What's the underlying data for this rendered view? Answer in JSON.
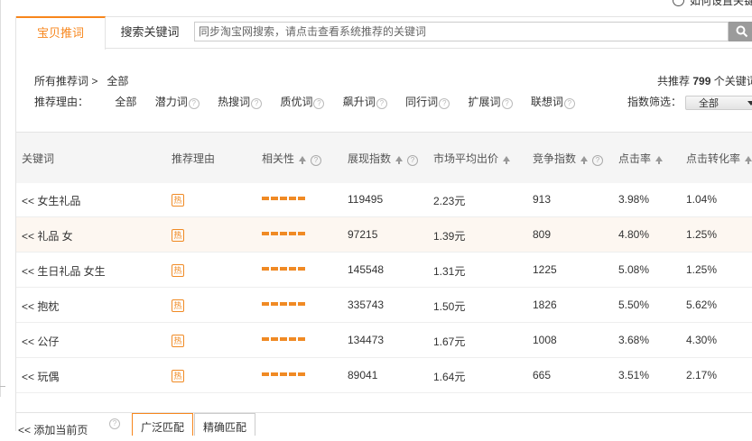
{
  "help_link": "如何设置关键",
  "tabs": [
    "宝贝推词",
    "搜索关键词"
  ],
  "search": {
    "placeholder": "同步淘宝网搜索，请点击查看系统推荐的关键词"
  },
  "breadcrumb": {
    "root": "所有推荐词 >",
    "current": "全部"
  },
  "reasons": {
    "label": "推荐理由：",
    "items": [
      "全部",
      "潜力词",
      "热搜词",
      "质优词",
      "飙升词",
      "同行词",
      "扩展词",
      "联想词"
    ]
  },
  "total": {
    "prefix": "共推荐",
    "count": "799",
    "suffix": "个关键词"
  },
  "filter": {
    "label": "指数筛选：",
    "value": "全部"
  },
  "columns": [
    "关键词",
    "推荐理由",
    "相关性",
    "展现指数",
    "市场平均出价",
    "竞争指数",
    "点击率",
    "点击转化率"
  ],
  "rows": [
    {
      "keyword": "<< 女生礼品",
      "reason": "热",
      "relevance": 5,
      "impressions": "119495",
      "bid": "2.23元",
      "competition": "913",
      "ctr": "3.98%",
      "cvr": "1.04%"
    },
    {
      "keyword": "<< 礼品 女",
      "reason": "热",
      "relevance": 5,
      "impressions": "97215",
      "bid": "1.39元",
      "competition": "809",
      "ctr": "4.80%",
      "cvr": "1.25%"
    },
    {
      "keyword": "<< 生日礼品 女生",
      "reason": "热",
      "relevance": 5,
      "impressions": "145548",
      "bid": "1.31元",
      "competition": "1225",
      "ctr": "5.08%",
      "cvr": "1.25%"
    },
    {
      "keyword": "<< 抱枕",
      "reason": "热",
      "relevance": 5,
      "impressions": "335743",
      "bid": "1.50元",
      "competition": "1826",
      "ctr": "5.50%",
      "cvr": "5.62%"
    },
    {
      "keyword": "<< 公仔",
      "reason": "热",
      "relevance": 5,
      "impressions": "134473",
      "bid": "1.67元",
      "competition": "1008",
      "ctr": "3.68%",
      "cvr": "4.30%"
    },
    {
      "keyword": "<< 玩偶",
      "reason": "热",
      "relevance": 5,
      "impressions": "89041",
      "bid": "1.64元",
      "competition": "665",
      "ctr": "3.51%",
      "cvr": "2.17%"
    }
  ],
  "footer": {
    "add_label": "<< 添加当前页",
    "broad_match": "广泛匹配",
    "exact_match": "精确匹配"
  },
  "colors": {
    "accent": "#f7861c",
    "highlight_row": "#fdf7f1"
  },
  "icons": {
    "search": "search-icon",
    "help": "help-icon",
    "sort": "sort-up-icon",
    "hot": "hot-badge-icon"
  }
}
